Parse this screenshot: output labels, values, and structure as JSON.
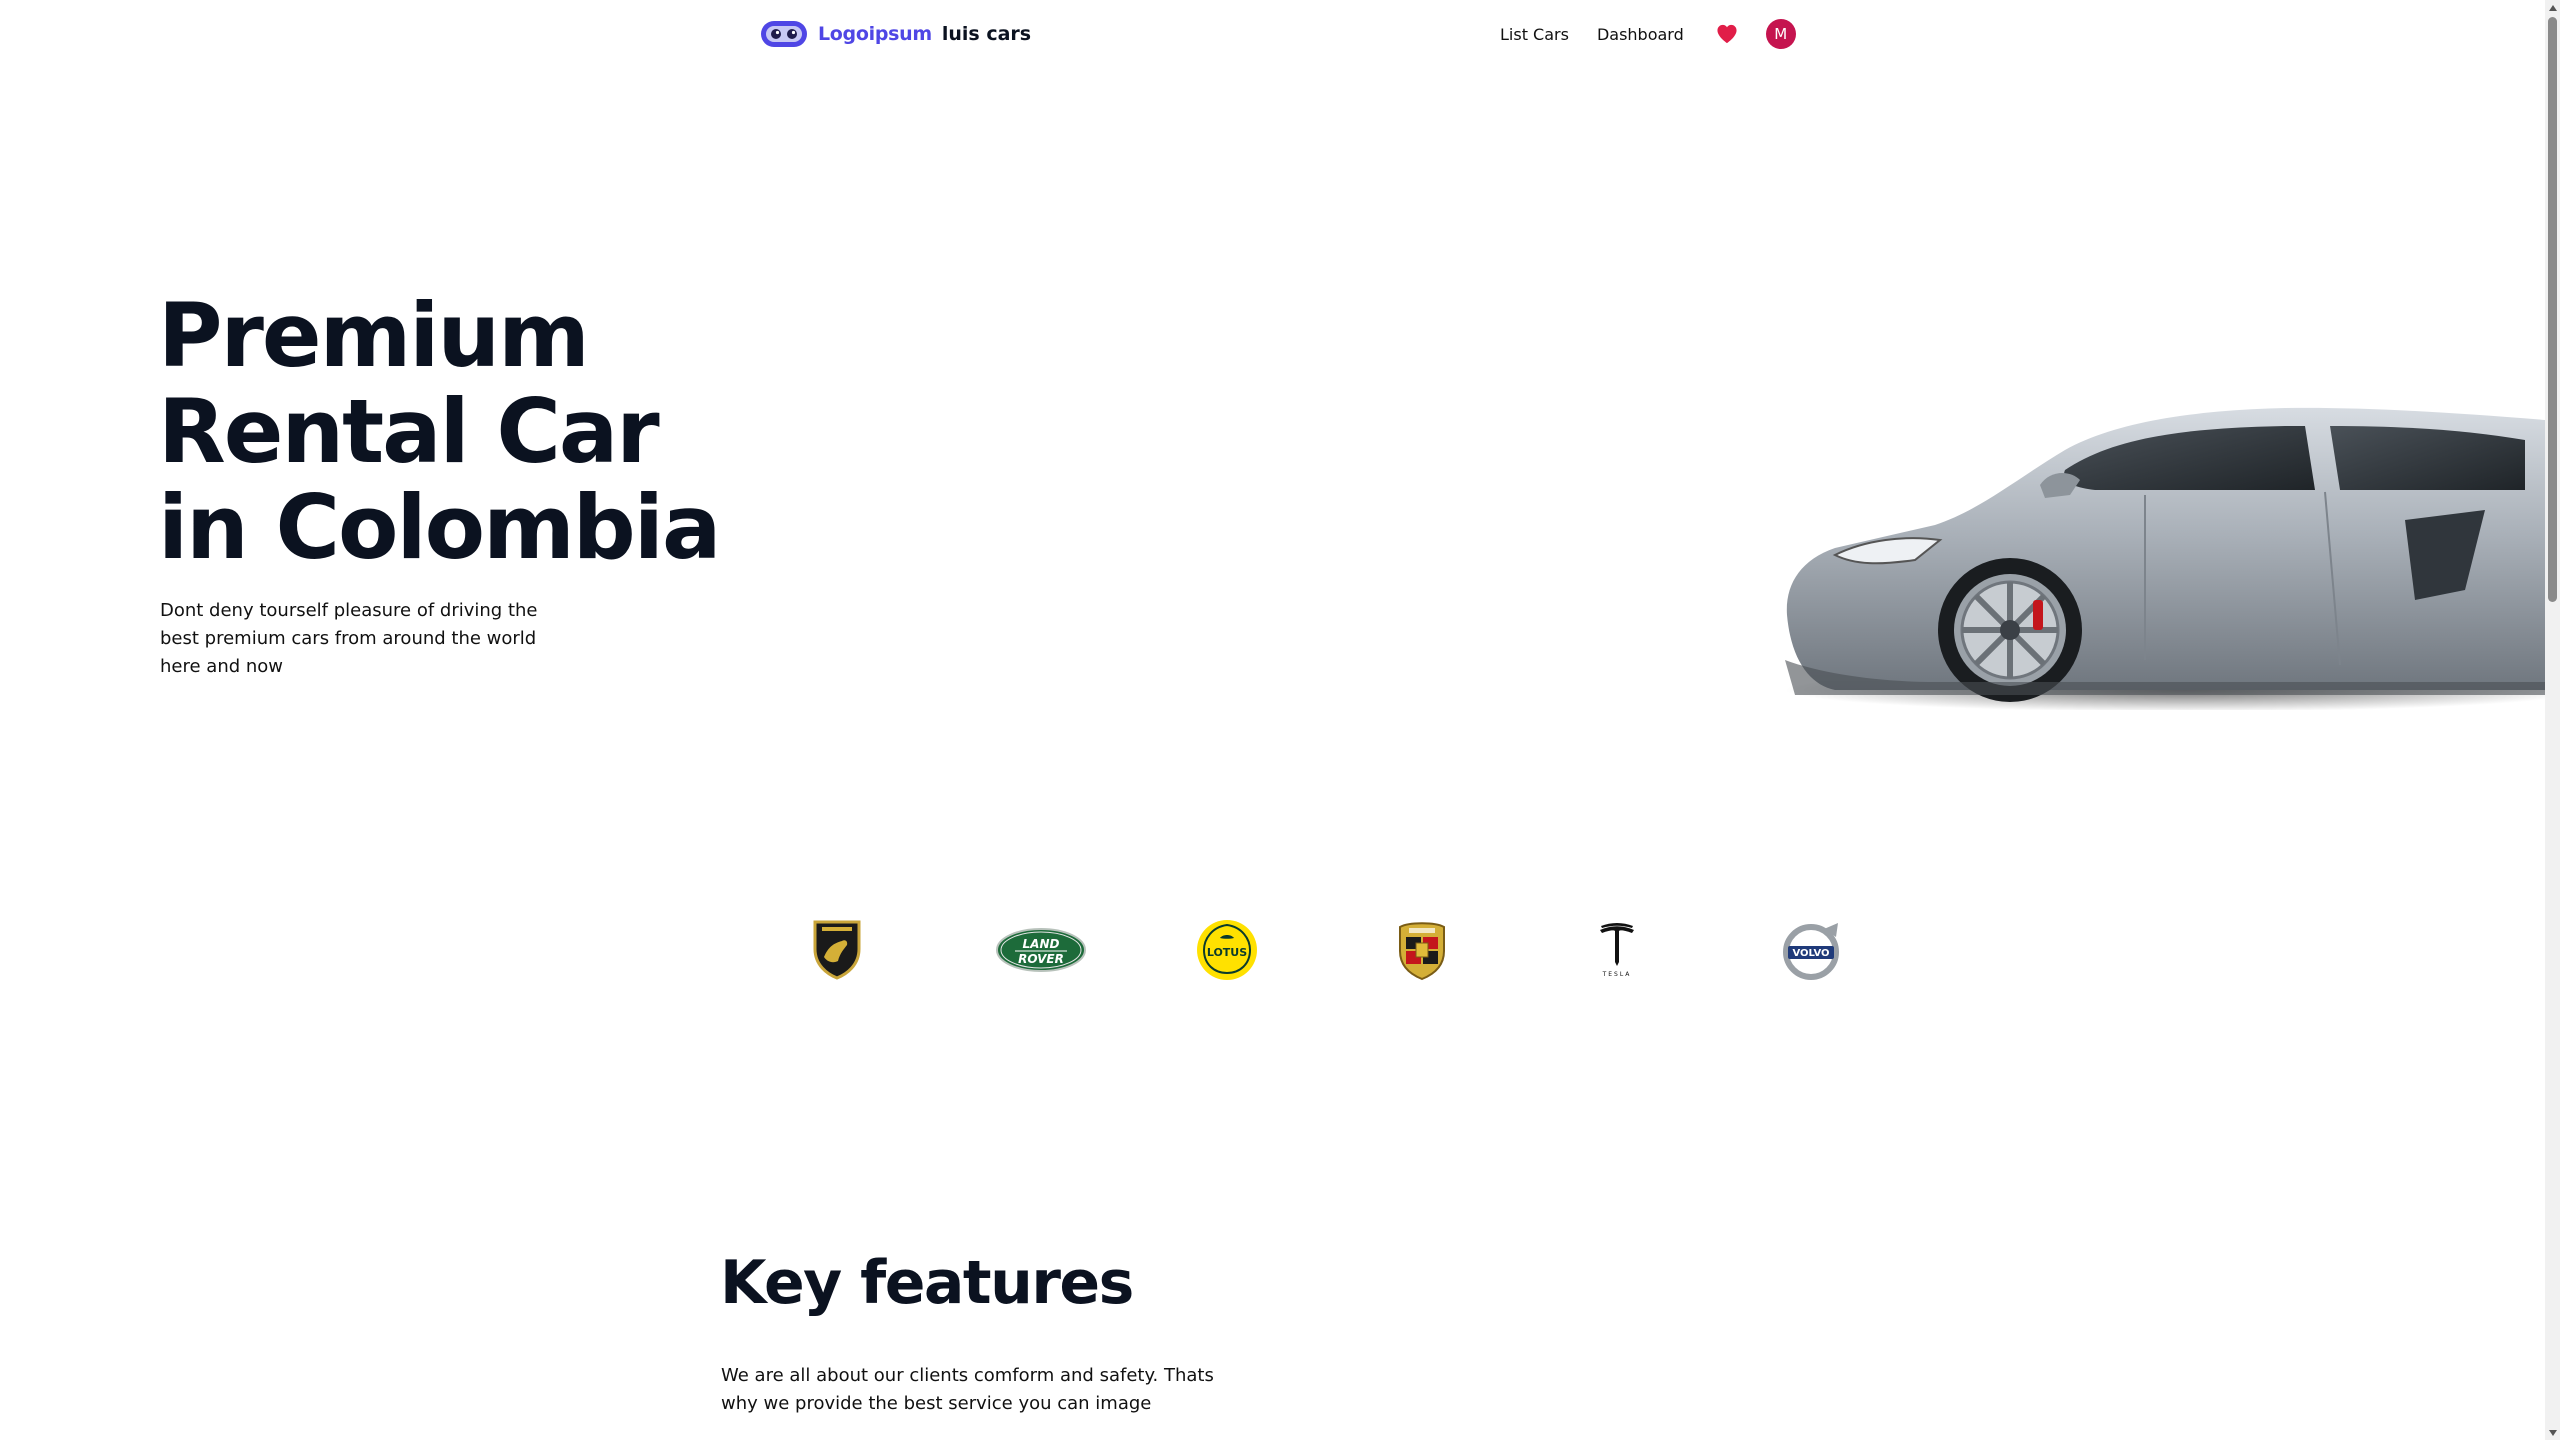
{
  "header": {
    "brand_name": "Logoipsum",
    "brand_suffix": "luis cars",
    "nav": [
      {
        "label": "List Cars"
      },
      {
        "label": "Dashboard"
      }
    ],
    "favorites_icon": "heart-icon",
    "avatar_initial": "M"
  },
  "hero": {
    "title_lines": [
      "Premium",
      "Rental Car",
      "in Colombia"
    ],
    "subtitle": "Dont deny tourself pleasure of driving the best premium cars from around the world here and now",
    "image": "silver-sports-car"
  },
  "brands": [
    {
      "name": "Lamborghini",
      "icon": "lamborghini-logo-icon"
    },
    {
      "name": "Land Rover",
      "icon": "land-rover-logo-icon",
      "text": "LAND ROVER"
    },
    {
      "name": "Lotus",
      "icon": "lotus-logo-icon",
      "text": "LOTUS"
    },
    {
      "name": "Porsche",
      "icon": "porsche-logo-icon"
    },
    {
      "name": "Tesla",
      "icon": "tesla-logo-icon",
      "text": "TESLA"
    },
    {
      "name": "Volvo",
      "icon": "volvo-logo-icon",
      "text": "VOLVO"
    }
  ],
  "features": {
    "title": "Key features",
    "subtitle": "We are all about our clients comform and safety. Thats why we provide the best service you can image"
  },
  "colors": {
    "brand": "#4f46e5",
    "text": "#0b1220",
    "heart": "#e11d48",
    "avatar": "#c5144f",
    "land_rover_green": "#1d6b3a",
    "lotus_yellow": "#ffe100",
    "volvo_blue": "#1f3a7a"
  }
}
